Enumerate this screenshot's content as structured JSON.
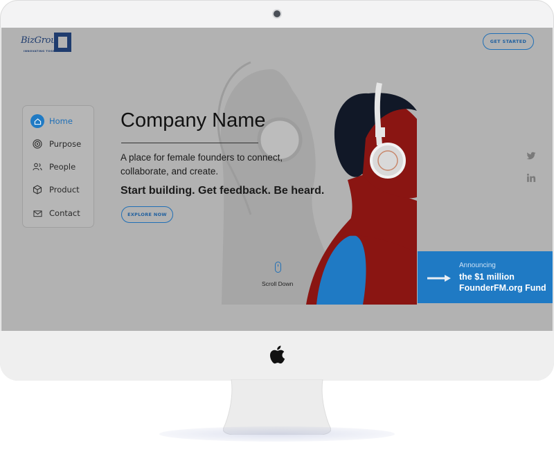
{
  "brand": {
    "logo_text": "BizGroup",
    "logo_tagline": "INNOVATING TOGETHER",
    "accent_color": "#1f7ac4"
  },
  "header": {
    "cta_label": "GET STARTED"
  },
  "nav": {
    "items": [
      {
        "label": "Home",
        "icon": "home-icon",
        "active": true
      },
      {
        "label": "Purpose",
        "icon": "target-icon",
        "active": false
      },
      {
        "label": "People",
        "icon": "people-icon",
        "active": false
      },
      {
        "label": "Product",
        "icon": "cube-icon",
        "active": false
      },
      {
        "label": "Contact",
        "icon": "mail-icon",
        "active": false
      }
    ]
  },
  "hero": {
    "title": "Company Name",
    "description": "A place for female founders to connect, collaborate, and create.",
    "tagline": "Start building. Get feedback. Be heard.",
    "cta_label": "EXPLORE NOW"
  },
  "scroll": {
    "label": "Scroll Down"
  },
  "social": {
    "icons": [
      "twitter-icon",
      "linkedin-icon"
    ]
  },
  "announcement": {
    "kicker": "Announcing",
    "headline_line1": "the $1 million",
    "headline_line2": "FounderFM.org Fund"
  }
}
